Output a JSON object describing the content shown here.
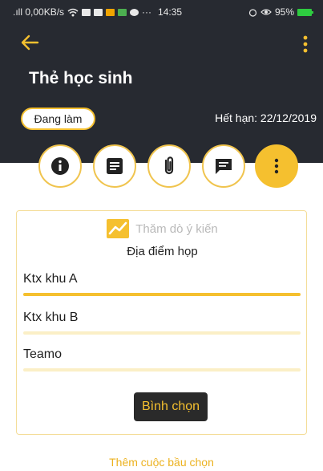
{
  "status_bar": {
    "network": ".ıll 0,00KB/s",
    "time": "14:35",
    "more": "···",
    "battery": "95%"
  },
  "header": {
    "title": "Thẻ học sinh",
    "status": "Đang làm",
    "expiry": "Hết hạn: 22/12/2019"
  },
  "tabs": [
    {
      "icon": "info-icon"
    },
    {
      "icon": "document-icon"
    },
    {
      "icon": "attachment-icon"
    },
    {
      "icon": "comment-icon"
    },
    {
      "icon": "more-vertical-icon",
      "active": true
    }
  ],
  "poll": {
    "section_title": "Thăm dò ý kiến",
    "question": "Địa điểm họp",
    "options": [
      {
        "label": "Ktx khu A",
        "progress": 1.0
      },
      {
        "label": "Ktx khu B",
        "progress": 0
      },
      {
        "label": "Teamo",
        "progress": 0
      }
    ],
    "vote_label": "Bình chọn"
  },
  "add_poll_label": "Thêm cuộc bầu chọn",
  "colors": {
    "accent": "#f5c02f",
    "header_bg": "#272a31",
    "track": "#fbefc6"
  }
}
